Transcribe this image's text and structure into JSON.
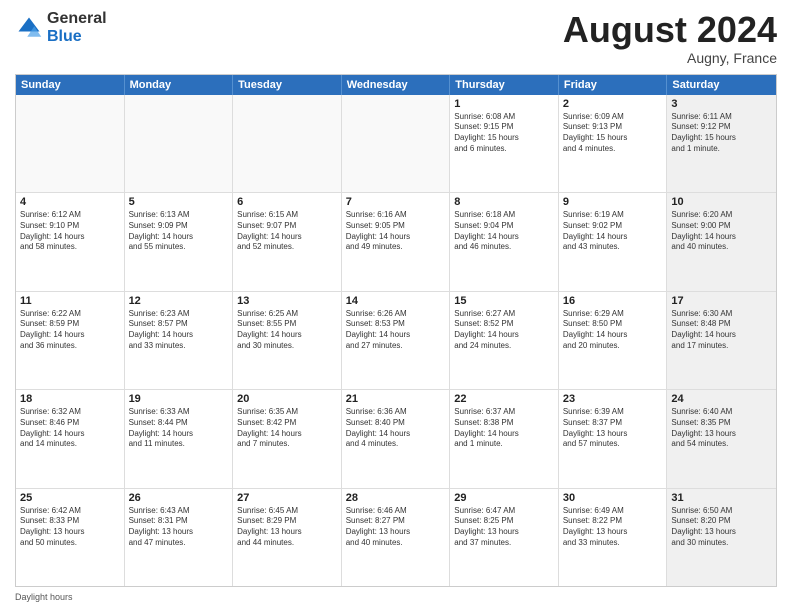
{
  "header": {
    "logo_general": "General",
    "logo_blue": "Blue",
    "month_title": "August 2024",
    "subtitle": "Augny, France"
  },
  "calendar": {
    "days_of_week": [
      "Sunday",
      "Monday",
      "Tuesday",
      "Wednesday",
      "Thursday",
      "Friday",
      "Saturday"
    ],
    "weeks": [
      [
        {
          "day": "",
          "info": "",
          "empty": true
        },
        {
          "day": "",
          "info": "",
          "empty": true
        },
        {
          "day": "",
          "info": "",
          "empty": true
        },
        {
          "day": "",
          "info": "",
          "empty": true
        },
        {
          "day": "1",
          "info": "Sunrise: 6:08 AM\nSunset: 9:15 PM\nDaylight: 15 hours\nand 6 minutes.",
          "shaded": false
        },
        {
          "day": "2",
          "info": "Sunrise: 6:09 AM\nSunset: 9:13 PM\nDaylight: 15 hours\nand 4 minutes.",
          "shaded": false
        },
        {
          "day": "3",
          "info": "Sunrise: 6:11 AM\nSunset: 9:12 PM\nDaylight: 15 hours\nand 1 minute.",
          "shaded": true
        }
      ],
      [
        {
          "day": "4",
          "info": "Sunrise: 6:12 AM\nSunset: 9:10 PM\nDaylight: 14 hours\nand 58 minutes.",
          "shaded": false
        },
        {
          "day": "5",
          "info": "Sunrise: 6:13 AM\nSunset: 9:09 PM\nDaylight: 14 hours\nand 55 minutes.",
          "shaded": false
        },
        {
          "day": "6",
          "info": "Sunrise: 6:15 AM\nSunset: 9:07 PM\nDaylight: 14 hours\nand 52 minutes.",
          "shaded": false
        },
        {
          "day": "7",
          "info": "Sunrise: 6:16 AM\nSunset: 9:05 PM\nDaylight: 14 hours\nand 49 minutes.",
          "shaded": false
        },
        {
          "day": "8",
          "info": "Sunrise: 6:18 AM\nSunset: 9:04 PM\nDaylight: 14 hours\nand 46 minutes.",
          "shaded": false
        },
        {
          "day": "9",
          "info": "Sunrise: 6:19 AM\nSunset: 9:02 PM\nDaylight: 14 hours\nand 43 minutes.",
          "shaded": false
        },
        {
          "day": "10",
          "info": "Sunrise: 6:20 AM\nSunset: 9:00 PM\nDaylight: 14 hours\nand 40 minutes.",
          "shaded": true
        }
      ],
      [
        {
          "day": "11",
          "info": "Sunrise: 6:22 AM\nSunset: 8:59 PM\nDaylight: 14 hours\nand 36 minutes.",
          "shaded": false
        },
        {
          "day": "12",
          "info": "Sunrise: 6:23 AM\nSunset: 8:57 PM\nDaylight: 14 hours\nand 33 minutes.",
          "shaded": false
        },
        {
          "day": "13",
          "info": "Sunrise: 6:25 AM\nSunset: 8:55 PM\nDaylight: 14 hours\nand 30 minutes.",
          "shaded": false
        },
        {
          "day": "14",
          "info": "Sunrise: 6:26 AM\nSunset: 8:53 PM\nDaylight: 14 hours\nand 27 minutes.",
          "shaded": false
        },
        {
          "day": "15",
          "info": "Sunrise: 6:27 AM\nSunset: 8:52 PM\nDaylight: 14 hours\nand 24 minutes.",
          "shaded": false
        },
        {
          "day": "16",
          "info": "Sunrise: 6:29 AM\nSunset: 8:50 PM\nDaylight: 14 hours\nand 20 minutes.",
          "shaded": false
        },
        {
          "day": "17",
          "info": "Sunrise: 6:30 AM\nSunset: 8:48 PM\nDaylight: 14 hours\nand 17 minutes.",
          "shaded": true
        }
      ],
      [
        {
          "day": "18",
          "info": "Sunrise: 6:32 AM\nSunset: 8:46 PM\nDaylight: 14 hours\nand 14 minutes.",
          "shaded": false
        },
        {
          "day": "19",
          "info": "Sunrise: 6:33 AM\nSunset: 8:44 PM\nDaylight: 14 hours\nand 11 minutes.",
          "shaded": false
        },
        {
          "day": "20",
          "info": "Sunrise: 6:35 AM\nSunset: 8:42 PM\nDaylight: 14 hours\nand 7 minutes.",
          "shaded": false
        },
        {
          "day": "21",
          "info": "Sunrise: 6:36 AM\nSunset: 8:40 PM\nDaylight: 14 hours\nand 4 minutes.",
          "shaded": false
        },
        {
          "day": "22",
          "info": "Sunrise: 6:37 AM\nSunset: 8:38 PM\nDaylight: 14 hours\nand 1 minute.",
          "shaded": false
        },
        {
          "day": "23",
          "info": "Sunrise: 6:39 AM\nSunset: 8:37 PM\nDaylight: 13 hours\nand 57 minutes.",
          "shaded": false
        },
        {
          "day": "24",
          "info": "Sunrise: 6:40 AM\nSunset: 8:35 PM\nDaylight: 13 hours\nand 54 minutes.",
          "shaded": true
        }
      ],
      [
        {
          "day": "25",
          "info": "Sunrise: 6:42 AM\nSunset: 8:33 PM\nDaylight: 13 hours\nand 50 minutes.",
          "shaded": false
        },
        {
          "day": "26",
          "info": "Sunrise: 6:43 AM\nSunset: 8:31 PM\nDaylight: 13 hours\nand 47 minutes.",
          "shaded": false
        },
        {
          "day": "27",
          "info": "Sunrise: 6:45 AM\nSunset: 8:29 PM\nDaylight: 13 hours\nand 44 minutes.",
          "shaded": false
        },
        {
          "day": "28",
          "info": "Sunrise: 6:46 AM\nSunset: 8:27 PM\nDaylight: 13 hours\nand 40 minutes.",
          "shaded": false
        },
        {
          "day": "29",
          "info": "Sunrise: 6:47 AM\nSunset: 8:25 PM\nDaylight: 13 hours\nand 37 minutes.",
          "shaded": false
        },
        {
          "day": "30",
          "info": "Sunrise: 6:49 AM\nSunset: 8:22 PM\nDaylight: 13 hours\nand 33 minutes.",
          "shaded": false
        },
        {
          "day": "31",
          "info": "Sunrise: 6:50 AM\nSunset: 8:20 PM\nDaylight: 13 hours\nand 30 minutes.",
          "shaded": true
        }
      ]
    ]
  },
  "footer": {
    "text": "Daylight hours"
  }
}
